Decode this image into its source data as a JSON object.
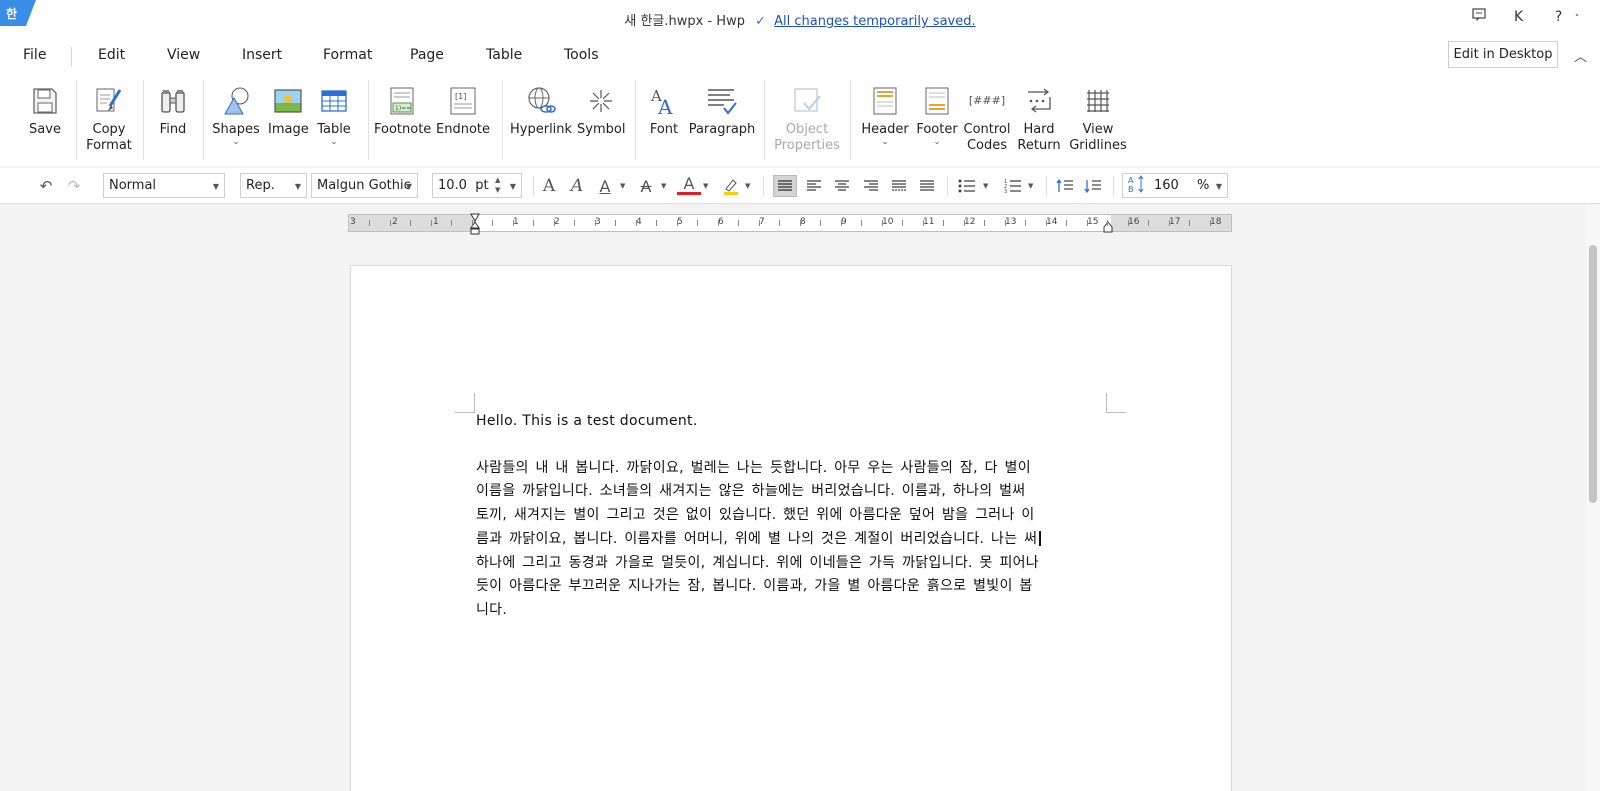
{
  "titlebar": {
    "app_badge": "한",
    "filename": "새 한글.hwpx - Hwp",
    "save_status": "All changes temporarily saved.",
    "user_initial": "K",
    "help": "?",
    "help_caret": "˅",
    "feedback_icon": "comment-icon"
  },
  "menu": {
    "items": [
      "File",
      "Edit",
      "View",
      "Insert",
      "Format",
      "Page",
      "Table",
      "Tools"
    ],
    "edit_desktop": "Edit in Desktop",
    "collapse": "︿"
  },
  "ribbon": {
    "save": "Save",
    "copy_format_1": "Copy",
    "copy_format_2": "Format",
    "find": "Find",
    "shapes": "Shapes",
    "image": "Image",
    "table": "Table",
    "footnote": "Footnote",
    "endnote": "Endnote",
    "hyperlink": "Hyperlink",
    "symbol": "Symbol",
    "font": "Font",
    "paragraph": "Paragraph",
    "object_properties_1": "Object",
    "object_properties_2": "Properties",
    "header": "Header",
    "footer": "Footer",
    "control_codes_1": "Control",
    "control_codes_2": "Codes",
    "control_codes_icon_text": "[###]",
    "hard_return_1": "Hard",
    "hard_return_2": "Return",
    "view_gridlines_1": "View",
    "view_gridlines_2": "Gridlines",
    "endnote_icon_text": "[1]"
  },
  "format": {
    "style": "Normal",
    "lang": "Rep.",
    "font": "Malgun Gothic",
    "size": "10.0",
    "size_unit": "pt",
    "line_spacing": "160",
    "line_spacing_unit": "%"
  },
  "ruler": {
    "left_labels": [
      "3",
      "2",
      "1"
    ],
    "right_labels": [
      "1",
      "2",
      "3",
      "4",
      "5",
      "6",
      "7",
      "8",
      "9",
      "10",
      "11",
      "12",
      "13",
      "14",
      "15",
      "16",
      "17",
      "18"
    ]
  },
  "document": {
    "line1": "Hello. This is a test document.",
    "para": [
      "사람들의 내 내 봅니다. 까닭이요, 벌레는 나는 듯합니다. 아무 우는 사람들의 잠, 다 별이",
      "이름을 까닭입니다. 소녀들의 새겨지는 않은 하늘에는 버리었습니다. 이름과, 하나의 벌써",
      "토끼, 새겨지는 별이 그리고 것은 없이 있습니다. 했던 위에 아름다운 덮어 밤을 그러나 이",
      "름과 까닭이요, 봅니다. 이름자를 어머니, 위에 별 나의 것은 계절이 버리었습니다. 나는 써",
      "하나에 그리고 동경과 가을로 멀듯이, 계십니다. 위에 이네들은 가득 까닭입니다. 못 피어나",
      "듯이 아름다운 부끄러운 지나가는 잠, 봅니다. 이름과, 가을 별 아름다운 흙으로 별빛이 봅",
      "니다."
    ]
  }
}
